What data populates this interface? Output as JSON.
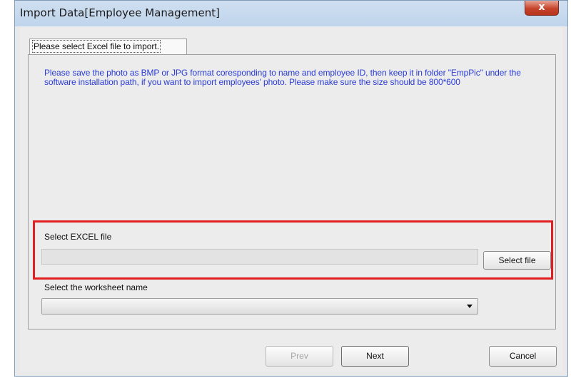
{
  "window": {
    "title": "Import Data[Employee Management]",
    "close_symbol": "x"
  },
  "tab": {
    "label": "Please select Excel file to import."
  },
  "info_text": "Please save the photo as BMP or JPG format coresponding to name and employee ID, then keep it in folder \"EmpPic\" under the software installation path, if you want to import employees' photo. Please make sure the size should be 800*600",
  "excel": {
    "label": "Select EXCEL file",
    "path_value": "",
    "select_button": "Select file"
  },
  "worksheet": {
    "label": "Select the worksheet name",
    "selected": ""
  },
  "buttons": {
    "prev": "Prev",
    "next": "Next",
    "cancel": "Cancel"
  },
  "colors": {
    "info_text": "#2a3bd6",
    "highlight": "#e02020",
    "close_button": "#c6442c"
  }
}
